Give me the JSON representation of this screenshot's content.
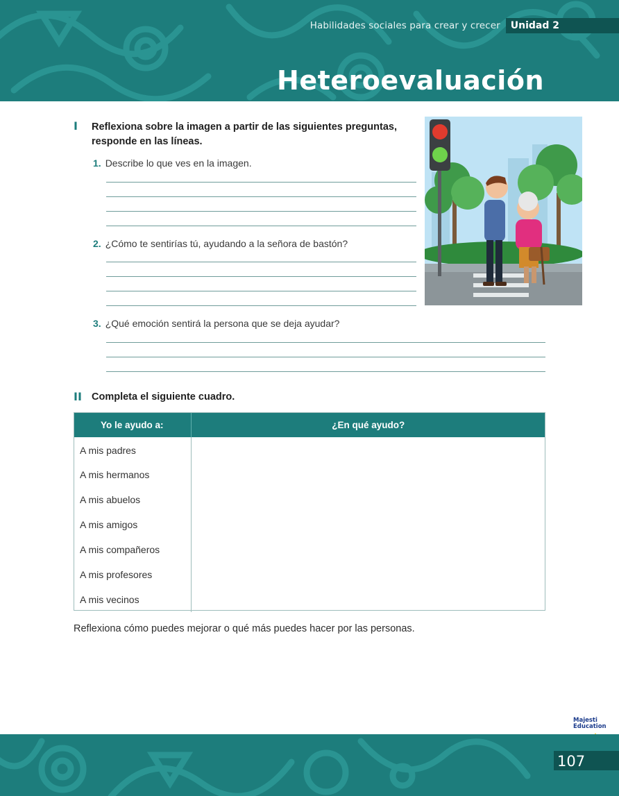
{
  "header": {
    "subject": "Habilidades sociales para crear y crecer",
    "unit": "Unidad 2",
    "title": "Heteroevaluación"
  },
  "section1": {
    "numeral": "I",
    "instruction_line1": "Reflexiona sobre la imagen a partir de las siguientes preguntas,",
    "instruction_line2": "responde en las líneas.",
    "questions": [
      {
        "num": "1.",
        "text": "Describe lo que ves en la imagen."
      },
      {
        "num": "2.",
        "text": "¿Cómo te sentirías tú, ayudando a la señora de bastón?"
      },
      {
        "num": "3.",
        "text": "¿Qué emoción sentirá la persona que se deja ayudar?"
      }
    ]
  },
  "section2": {
    "numeral": "II",
    "instruction": "Completa el siguiente cuadro.",
    "table": {
      "headers": [
        "Yo le ayudo a:",
        "¿En qué ayudo?"
      ],
      "rows": [
        "A mis padres",
        "A mis hermanos",
        "A mis abuelos",
        "A mis amigos",
        "A mis compañeros",
        "A mis profesores",
        "A mis vecinos"
      ]
    }
  },
  "closing": "Reflexiona cómo puedes mejorar o qué más puedes hacer por las personas.",
  "footer": {
    "logo_line1": "Majesti",
    "logo_line2": "Education",
    "page_number": "107"
  },
  "colors": {
    "teal": "#1d7d7c",
    "dark_teal": "#0f5452"
  },
  "icons": [
    "traffic-light-icon",
    "logo-star-icon"
  ]
}
